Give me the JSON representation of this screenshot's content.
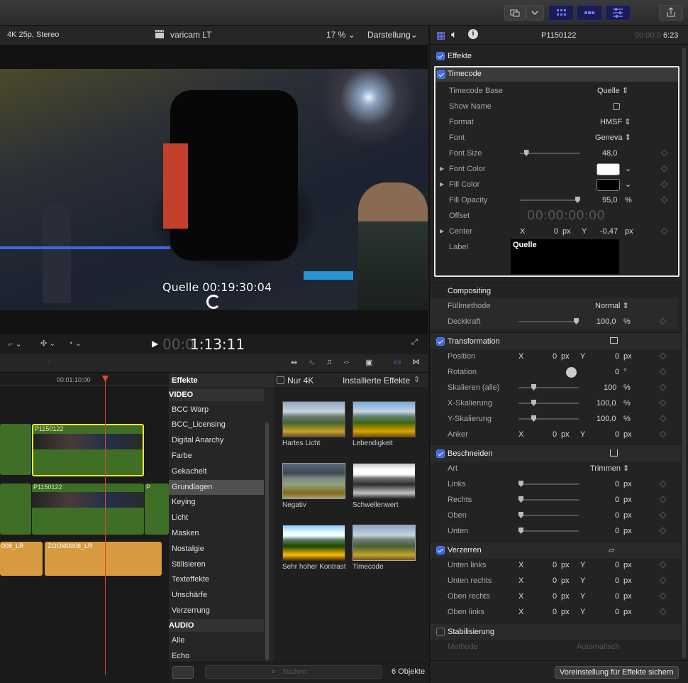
{
  "viewer": {
    "format": "4K 25p, Stereo",
    "library": "varicam LT",
    "zoom": "17 %",
    "view": "Darstellung",
    "overlay_timecode": "Quelle 00:19:30:04"
  },
  "transport": {
    "timecode_dim": "00:0",
    "timecode": "1:13:11"
  },
  "timeline": {
    "ruler_time": "00:01:10:00",
    "clip1": "P1150122",
    "clip2": "P1150122",
    "clip2b": "P",
    "audio1": "008_LR",
    "audio2": "ZOOM0008_LR"
  },
  "effects": {
    "header": "Effekte",
    "only4k": "Nur 4K",
    "installed": "Installierte Effekte",
    "video_head": "VIDEO",
    "categories": [
      "BCC Warp",
      "BCC_Licensing",
      "Digital Anarchy",
      "Farbe",
      "Gekachelt",
      "Grundlagen",
      "Keying",
      "Licht",
      "Masken",
      "Nostalgie",
      "Stilisieren",
      "Texteffekte",
      "Unschärfe",
      "Verzerrung"
    ],
    "audio_head": "AUDIO",
    "audio_categories": [
      "Alle",
      "Echo"
    ],
    "thumbs": [
      "Hartes Licht",
      "Lebendigkeit",
      "Negativ",
      "Schwellenwert",
      "Sehr hoher Kontrast",
      "Timecode"
    ],
    "search_placeholder": "Suchen",
    "count": "6 Objekte"
  },
  "inspector": {
    "clip_name": "P1150122",
    "duration_dim": "00:00:0",
    "duration": "6:23",
    "effects_label": "Effekte",
    "timecode": {
      "title": "Timecode",
      "base_label": "Timecode Base",
      "base_value": "Quelle",
      "showname_label": "Show Name",
      "format_label": "Format",
      "format_value": "HMSF",
      "font_label": "Font",
      "font_value": "Geneva",
      "fontsize_label": "Font Size",
      "fontsize_value": "48,0",
      "fontcolor_label": "Font Color",
      "fillcolor_label": "Fill Color",
      "fillopacity_label": "Fill Opacity",
      "fillopacity_value": "95,0",
      "pct": "%",
      "offset_label": "Offset",
      "offset_value": "00:00:00:00",
      "center_label": "Center",
      "center_x_label": "X",
      "center_x": "0",
      "center_y_label": "Y",
      "center_y": "-0,47",
      "px": "px",
      "label_label": "Label",
      "label_value": "Quelle",
      "fontsize_frac": 0.1,
      "fillopacity_frac": 0.95
    },
    "compositing": {
      "title": "Compositing",
      "blend_label": "Füllmethode",
      "blend_value": "Normal",
      "opacity_label": "Deckkraft",
      "opacity_value": "100,0",
      "pct": "%"
    },
    "transform": {
      "title": "Transformation",
      "position_label": "Position",
      "rotation_label": "Rotation",
      "rotation_value": "0",
      "deg": "°",
      "scale_label": "Skalieren (alle)",
      "scale_value": "100",
      "scalex_label": "X-Skalierung",
      "scalex_value": "100,0",
      "scaley_label": "Y-Skalierung",
      "scaley_value": "100,0",
      "anchor_label": "Anker",
      "x": "X",
      "y": "Y",
      "zero": "0",
      "px": "px",
      "pct": "%"
    },
    "crop": {
      "title": "Beschneiden",
      "type_label": "Art",
      "type_value": "Trimmen",
      "left_label": "Links",
      "right_label": "Rechts",
      "top_label": "Oben",
      "bottom_label": "Unten",
      "zero": "0",
      "px": "px"
    },
    "distort": {
      "title": "Verzerren",
      "bl_label": "Unten links",
      "br_label": "Unten rechts",
      "tr_label": "Oben rechts",
      "tl_label": "Oben links",
      "x": "X",
      "y": "Y",
      "zero": "0",
      "px": "px"
    },
    "stabilize": {
      "title": "Stabilisierung",
      "method_label": "Methode",
      "method_value": "Automatisch"
    },
    "save_preset": "Voreinstellung für Effekte sichern"
  },
  "colors": {
    "accent": "#3a68e0",
    "selected_clip": "#e8e83a",
    "playhead": "#e04a2a",
    "video_clip": "#3f6e26",
    "audio_clip": "#d89a3e"
  }
}
